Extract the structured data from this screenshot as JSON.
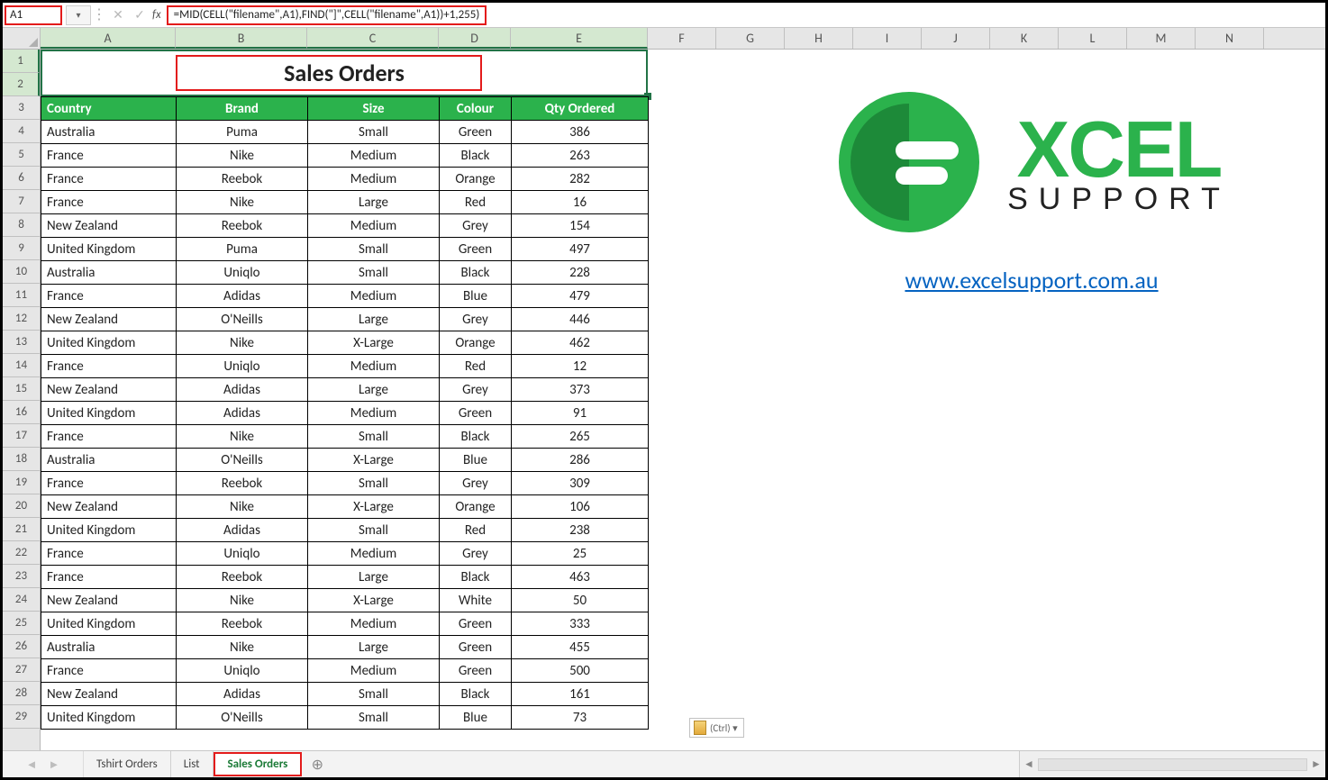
{
  "name_box": "A1",
  "formula": "=MID(CELL(\"filename\",A1),FIND(\"]\",CELL(\"filename\",A1))+1,255)",
  "columns": [
    "A",
    "B",
    "C",
    "D",
    "E",
    "F",
    "G",
    "H",
    "I",
    "J",
    "K",
    "L",
    "M",
    "N"
  ],
  "selected_cols": 5,
  "row_numbers": [
    1,
    2,
    3,
    4,
    5,
    6,
    7,
    8,
    9,
    10,
    11,
    12,
    13,
    14,
    15,
    16,
    17,
    18,
    19,
    20,
    21,
    22,
    23,
    24,
    25,
    26,
    27,
    28,
    29
  ],
  "selected_rows": 2,
  "title_cell": "Sales Orders",
  "headers": [
    "Country",
    "Brand",
    "Size",
    "Colour",
    "Qty Ordered"
  ],
  "rows": [
    [
      "Australia",
      "Puma",
      "Small",
      "Green",
      "386"
    ],
    [
      "France",
      "Nike",
      "Medium",
      "Black",
      "263"
    ],
    [
      "France",
      "Reebok",
      "Medium",
      "Orange",
      "282"
    ],
    [
      "France",
      "Nike",
      "Large",
      "Red",
      "16"
    ],
    [
      "New Zealand",
      "Reebok",
      "Medium",
      "Grey",
      "154"
    ],
    [
      "United Kingdom",
      "Puma",
      "Small",
      "Green",
      "497"
    ],
    [
      "Australia",
      "Uniqlo",
      "Small",
      "Black",
      "228"
    ],
    [
      "France",
      "Adidas",
      "Medium",
      "Blue",
      "479"
    ],
    [
      "New Zealand",
      "O'Neills",
      "Large",
      "Grey",
      "446"
    ],
    [
      "United Kingdom",
      "Nike",
      "X-Large",
      "Orange",
      "462"
    ],
    [
      "France",
      "Uniqlo",
      "Medium",
      "Red",
      "12"
    ],
    [
      "New Zealand",
      "Adidas",
      "Large",
      "Grey",
      "373"
    ],
    [
      "United Kingdom",
      "Adidas",
      "Medium",
      "Green",
      "91"
    ],
    [
      "France",
      "Nike",
      "Small",
      "Black",
      "265"
    ],
    [
      "Australia",
      "O'Neills",
      "X-Large",
      "Blue",
      "286"
    ],
    [
      "France",
      "Reebok",
      "Small",
      "Grey",
      "309"
    ],
    [
      "New Zealand",
      "Nike",
      "X-Large",
      "Orange",
      "106"
    ],
    [
      "United Kingdom",
      "Adidas",
      "Small",
      "Red",
      "238"
    ],
    [
      "France",
      "Uniqlo",
      "Medium",
      "Grey",
      "25"
    ],
    [
      "France",
      "Reebok",
      "Large",
      "Black",
      "463"
    ],
    [
      "New Zealand",
      "Nike",
      "X-Large",
      "White",
      "50"
    ],
    [
      "United Kingdom",
      "Reebok",
      "Medium",
      "Green",
      "333"
    ],
    [
      "Australia",
      "Nike",
      "Large",
      "Green",
      "455"
    ],
    [
      "France",
      "Uniqlo",
      "Medium",
      "Green",
      "500"
    ],
    [
      "New Zealand",
      "Adidas",
      "Small",
      "Black",
      "161"
    ],
    [
      "United Kingdom",
      "O'Neills",
      "Small",
      "Blue",
      "73"
    ]
  ],
  "logo": {
    "word": "XCEL",
    "sub": "SUPPORT"
  },
  "link_text": "www.excelsupport.com.au",
  "paste_options_label": "(Ctrl) ▾",
  "tabs": [
    "Tshirt Orders",
    "List",
    "Sales Orders"
  ],
  "active_tab_index": 2
}
